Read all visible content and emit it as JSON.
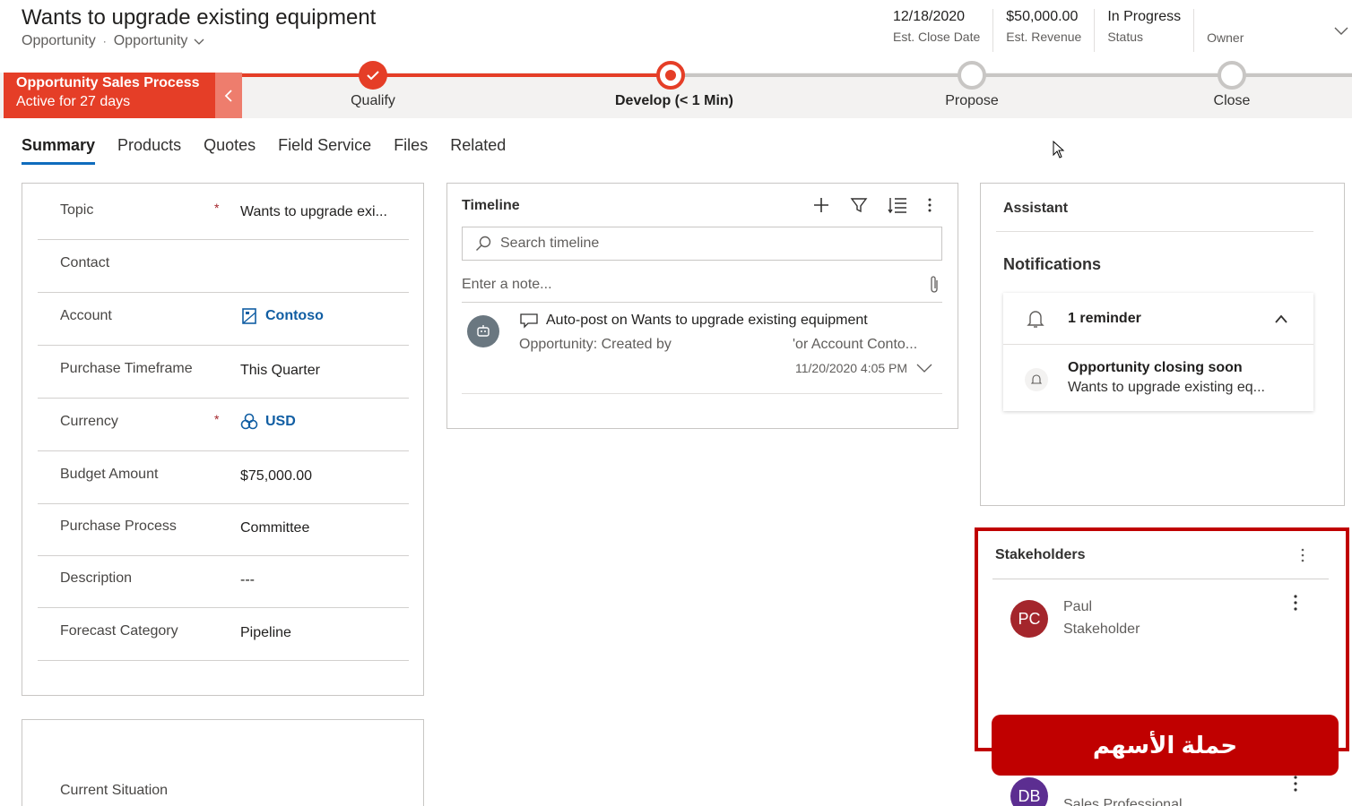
{
  "header": {
    "title": "Wants to upgrade existing equipment",
    "entity": "Opportunity",
    "form": "Opportunity",
    "kpis": [
      {
        "value": "12/18/2020",
        "label": "Est. Close Date"
      },
      {
        "value": "$50,000.00",
        "label": "Est. Revenue"
      },
      {
        "value": "In Progress",
        "label": "Status"
      },
      {
        "value": "",
        "label": "Owner"
      }
    ]
  },
  "process": {
    "name": "Opportunity Sales Process",
    "active": "Active for 27 days",
    "stages": [
      {
        "label": "Qualify",
        "state": "complete"
      },
      {
        "label": "Develop  (< 1 Min)",
        "state": "active"
      },
      {
        "label": "Propose",
        "state": "pending"
      },
      {
        "label": "Close",
        "state": "pending"
      }
    ],
    "colors": {
      "active": "#e53e27",
      "pending": "#c8c6c4"
    }
  },
  "tabs": [
    "Summary",
    "Products",
    "Quotes",
    "Field Service",
    "Files",
    "Related"
  ],
  "summary": {
    "fields": [
      {
        "label": "Topic",
        "required": "*",
        "value": "Wants to upgrade exi...",
        "type": "text"
      },
      {
        "label": "Contact",
        "required": "",
        "value": "",
        "type": "text"
      },
      {
        "label": "Account",
        "required": "",
        "value": "Contoso",
        "type": "link",
        "icon": "account-icon"
      },
      {
        "label": "Purchase Timeframe",
        "required": "",
        "value": "This Quarter",
        "type": "text"
      },
      {
        "label": "Currency",
        "required": "*",
        "value": "USD",
        "type": "link",
        "icon": "currency-icon"
      },
      {
        "label": "Budget Amount",
        "required": "",
        "value": "$75,000.00",
        "type": "text"
      },
      {
        "label": "Purchase Process",
        "required": "",
        "value": "Committee",
        "type": "text"
      },
      {
        "label": "Description",
        "required": "",
        "value": "---",
        "type": "text"
      },
      {
        "label": "Forecast Category",
        "required": "",
        "value": "Pipeline",
        "type": "text"
      }
    ],
    "current_situation_label": "Current Situation"
  },
  "timeline": {
    "title": "Timeline",
    "search_placeholder": "Search timeline",
    "note_placeholder": "Enter a note...",
    "entry": {
      "title": "Auto-post on Wants to upgrade existing equipment",
      "sub1": "Opportunity: Created by",
      "sub2": "'or Account Conto...",
      "date": "11/20/2020 4:05 PM"
    }
  },
  "assistant": {
    "title": "Assistant",
    "notifications_title": "Notifications",
    "reminder_count": "1 reminder",
    "item_title": "Opportunity closing soon",
    "item_text": "Wants to upgrade existing eq..."
  },
  "stakeholders": {
    "title": "Stakeholders",
    "people": [
      {
        "initials": "PC",
        "name": "Paul",
        "role": "Stakeholder"
      },
      {
        "initials": "DB",
        "name": "",
        "role": "Sales Professional"
      }
    ]
  },
  "overlay": {
    "banner_text": "حملة الأسهم",
    "highlight_color": "#c00000"
  }
}
